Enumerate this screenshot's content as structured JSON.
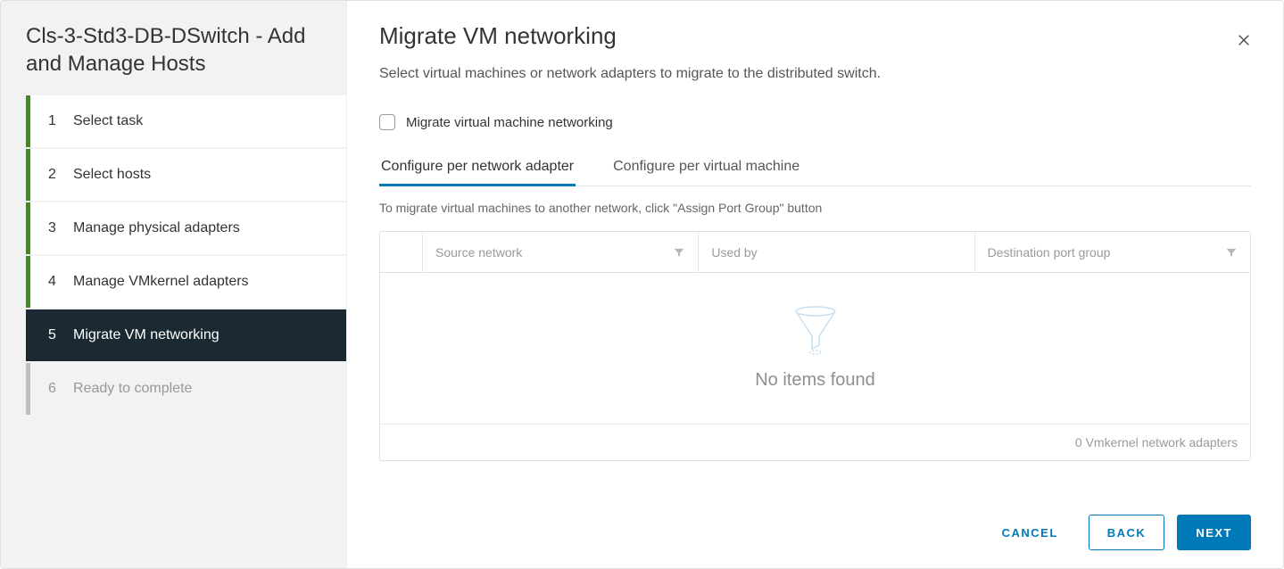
{
  "sidebar": {
    "title": "Cls-3-Std3-DB-DSwitch - Add and Manage Hosts",
    "steps": [
      {
        "num": "1",
        "label": "Select task",
        "state": "completed"
      },
      {
        "num": "2",
        "label": "Select hosts",
        "state": "completed"
      },
      {
        "num": "3",
        "label": "Manage physical adapters",
        "state": "completed"
      },
      {
        "num": "4",
        "label": "Manage VMkernel adapters",
        "state": "completed"
      },
      {
        "num": "5",
        "label": "Migrate VM networking",
        "state": "active"
      },
      {
        "num": "6",
        "label": "Ready to complete",
        "state": "upcoming"
      }
    ]
  },
  "main": {
    "title": "Migrate VM networking",
    "description": "Select virtual machines or network adapters to migrate to the distributed switch.",
    "checkbox_label": "Migrate virtual machine networking",
    "tabs": [
      {
        "label": "Configure per network adapter",
        "active": true
      },
      {
        "label": "Configure per virtual machine",
        "active": false
      }
    ],
    "helper": "To migrate virtual machines to another network, click \"Assign Port Group\" button",
    "columns": {
      "c1": "Source network",
      "c2": "Used by",
      "c3": "Destination port group"
    },
    "empty_text": "No items found",
    "footer_count": "0 Vmkernel network adapters"
  },
  "buttons": {
    "cancel": "CANCEL",
    "back": "BACK",
    "next": "NEXT"
  }
}
